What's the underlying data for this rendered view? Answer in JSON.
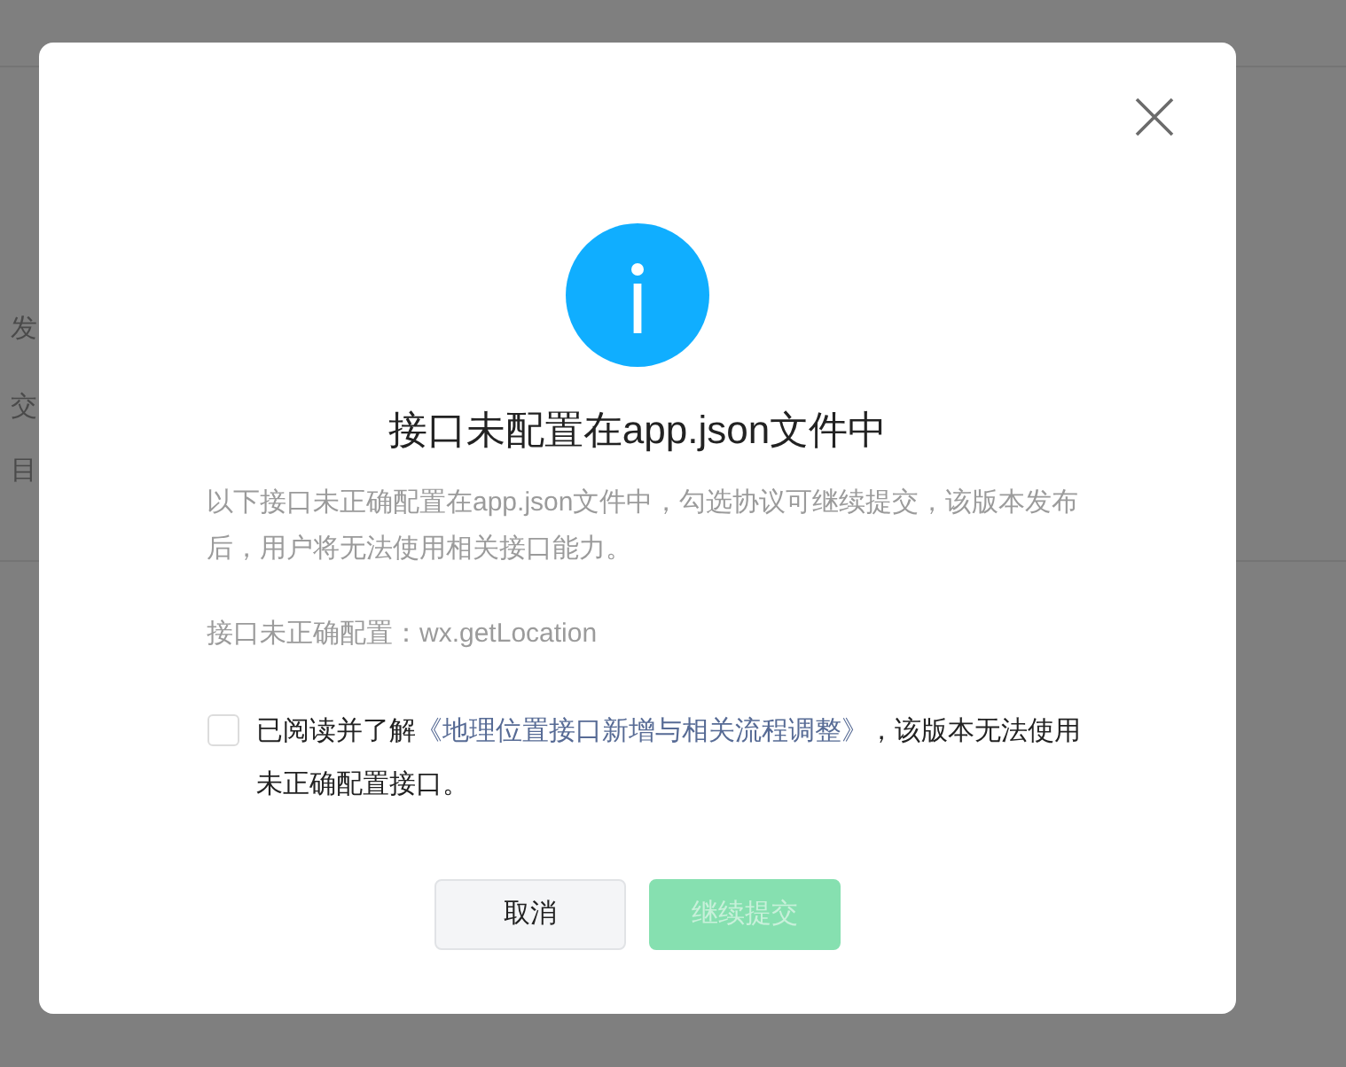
{
  "background": {
    "fragments": [
      "发",
      "交",
      "目"
    ]
  },
  "dialog": {
    "title": "接口未配置在app.json文件中",
    "description": "以下接口未正确配置在app.json文件中，勾选协议可继续提交，该版本发布后，用户将无法使用相关接口能力。",
    "config_line": "接口未正确配置：wx.getLocation",
    "agreement": {
      "checked": false,
      "prefix": "已阅读并了解",
      "link": "《地理位置接口新增与相关流程调整》",
      "suffix": "，该版本无法使用未正确配置接口。"
    },
    "buttons": [
      {
        "label": "取消",
        "kind": "cancel",
        "disabled": false
      },
      {
        "label": "继续提交",
        "kind": "primary",
        "disabled": true
      }
    ]
  }
}
